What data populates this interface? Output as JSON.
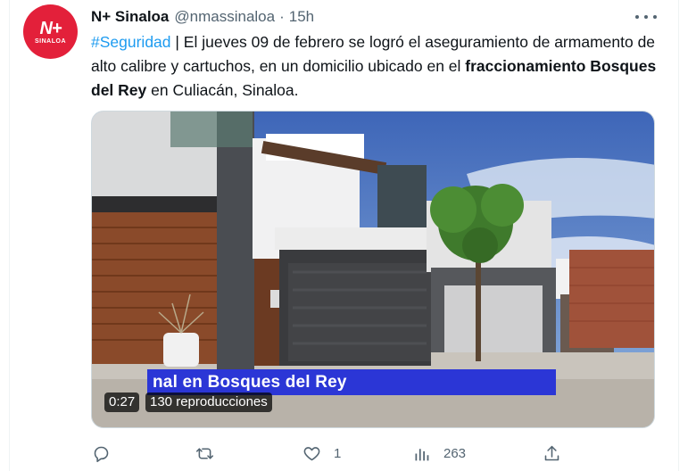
{
  "tweet": {
    "avatar": {
      "logo_mark": "N+",
      "logo_sub": "SINALOA",
      "color": "#e3203a"
    },
    "author_name": "N+ Sinaloa",
    "handle": "@nmassinaloa",
    "separator": "·",
    "time": "15h",
    "more_icon": "more-horizontal-icon",
    "text": {
      "hashtag": "#Seguridad",
      "part1": " | El jueves 09 de febrero se logró el aseguramiento de armamento de alto calibre y cartuchos, en un domicilio ubicado en el ",
      "bold": "fraccionamiento Bosques del Rey",
      "part2": " en Culiacán, Sinaloa."
    },
    "video": {
      "caption_banner": "nal en Bosques del Rey",
      "duration": "0:27",
      "views": "130 reproducciones"
    },
    "actions": {
      "reply": {
        "icon": "reply-icon",
        "count": ""
      },
      "retweet": {
        "icon": "retweet-icon",
        "count": ""
      },
      "like": {
        "icon": "heart-icon",
        "count": "1"
      },
      "views": {
        "icon": "analytics-icon",
        "count": "263"
      },
      "share": {
        "icon": "share-icon",
        "count": ""
      }
    },
    "colors": {
      "link": "#1d9bf0",
      "muted": "#536471",
      "banner": "#2b36d6"
    }
  }
}
